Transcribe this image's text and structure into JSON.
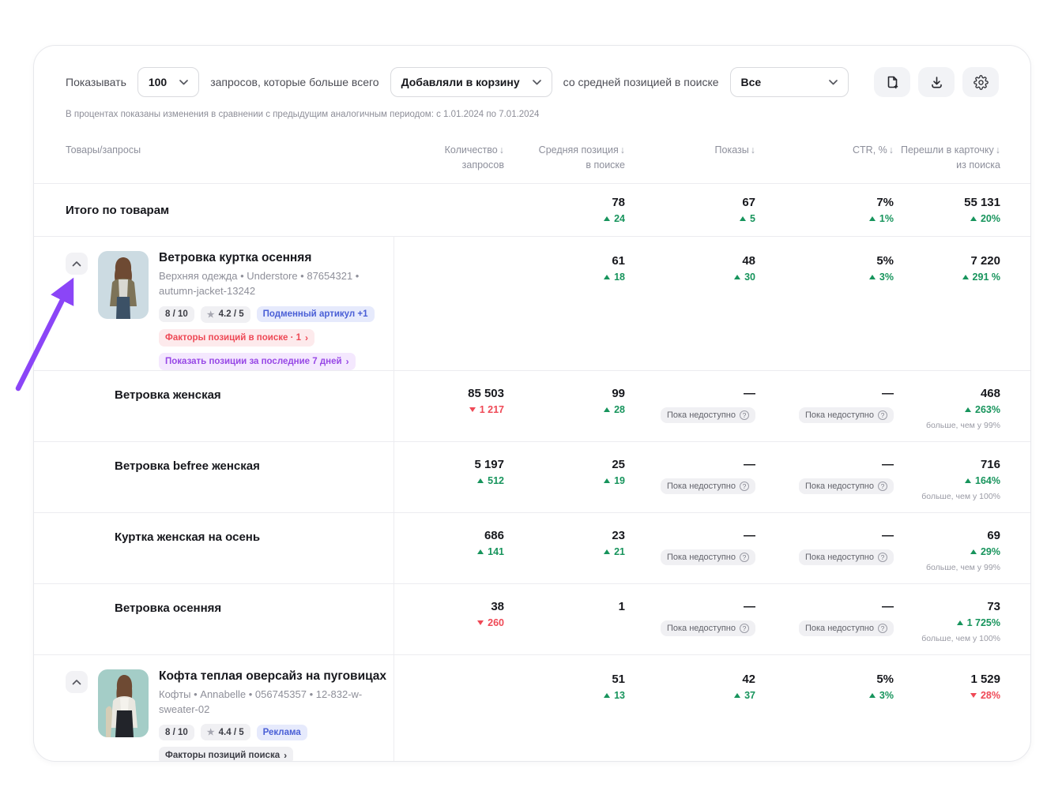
{
  "colors": {
    "accent_purple": "#8b45f7",
    "green": "#17945c",
    "red": "#ef4956",
    "blue_badge": "#4a5fd6"
  },
  "filters": {
    "show_label": "Показывать",
    "count_value": "100",
    "after_count_text": "запросов, которые больше всего",
    "action_value": "Добавляли в корзину",
    "position_label": "со средней позицией в поиске",
    "position_value": "Все"
  },
  "toolbar_icons": [
    "file-add-icon",
    "download-icon",
    "settings-gear-icon"
  ],
  "note": "В процентах показаны изменения в сравнении с предыдущим аналогичным периодом: с 1.01.2024 по 7.01.2024",
  "table": {
    "headers": {
      "products": "Товары/запросы",
      "qty_line1": "Количество",
      "qty_line2": "запросов",
      "pos_line1": "Средняя позиция",
      "pos_line2": "в поиске",
      "shows": "Показы",
      "ctr": "CTR, %",
      "clicks_line1": "Перешли в карточку",
      "clicks_line2": "из поиска",
      "sort_arrow": "↓"
    },
    "unavailable_label": "Пока недоступно",
    "unavailable_help": "?",
    "totals": {
      "label": "Итого по товарам",
      "pos": "78",
      "pos_change": "24",
      "shows": "67",
      "shows_change": "5",
      "ctr": "7%",
      "ctr_change": "1%",
      "clicks": "55 131",
      "clicks_change": "20%"
    },
    "product1": {
      "title": "Ветровка куртка осенняя",
      "meta": "Верхняя одежда • Understore • 87654321 • autumn-jacket-13242",
      "score": "8 / 10",
      "star": "★",
      "rating": "4.2 / 5",
      "badge": "Подменный артикул +1",
      "factors_pill": "Факторы позиций в поиске · 1",
      "positions_pill": "Показать позиции за последние 7 дней",
      "chevron": "›",
      "pos": "61",
      "pos_change": "18",
      "shows": "48",
      "shows_change": "30",
      "ctr": "5%",
      "ctr_change": "3%",
      "clicks": "7 220",
      "clicks_change": "291 %"
    },
    "queries": [
      {
        "name": "Ветровка женская",
        "qty": "85 503",
        "qty_change": "1 217",
        "pos": "99",
        "pos_change": "28",
        "na": "—",
        "clicks": "468",
        "clicks_change": "263%",
        "clicks_note": "больше, чем у 99%"
      },
      {
        "name": "Ветровка befree женская",
        "qty": "5 197",
        "qty_change": "512",
        "pos": "25",
        "pos_change": "19",
        "na": "—",
        "clicks": "716",
        "clicks_change": "164%",
        "clicks_note": "больше, чем у 100%"
      },
      {
        "name": "Куртка женская на осень",
        "qty": "686",
        "qty_change": "141",
        "pos": "23",
        "pos_change": "21",
        "na": "—",
        "clicks": "69",
        "clicks_change": "29%",
        "clicks_note": "больше, чем у 99%"
      },
      {
        "name": "Ветровка осенняя",
        "qty": "38",
        "qty_change": "260",
        "pos": "1",
        "na": "—",
        "clicks": "73",
        "clicks_change": "1 725%",
        "clicks_note": "больше, чем у 100%"
      }
    ],
    "product2": {
      "title": "Кофта теплая оверсайз на пуговицах",
      "meta": "Кофты • Annabelle • 056745357 • 12-832-w-sweater-02",
      "score": "8 / 10",
      "star": "★",
      "rating": "4.4 / 5",
      "badge": "Реклама",
      "factors_pill": "Факторы позиций поиска",
      "chevron": "›",
      "pos": "51",
      "pos_change": "13",
      "shows": "42",
      "shows_change": "37",
      "ctr": "5%",
      "ctr_change": "3%",
      "clicks": "1 529",
      "clicks_change": "28%"
    }
  }
}
